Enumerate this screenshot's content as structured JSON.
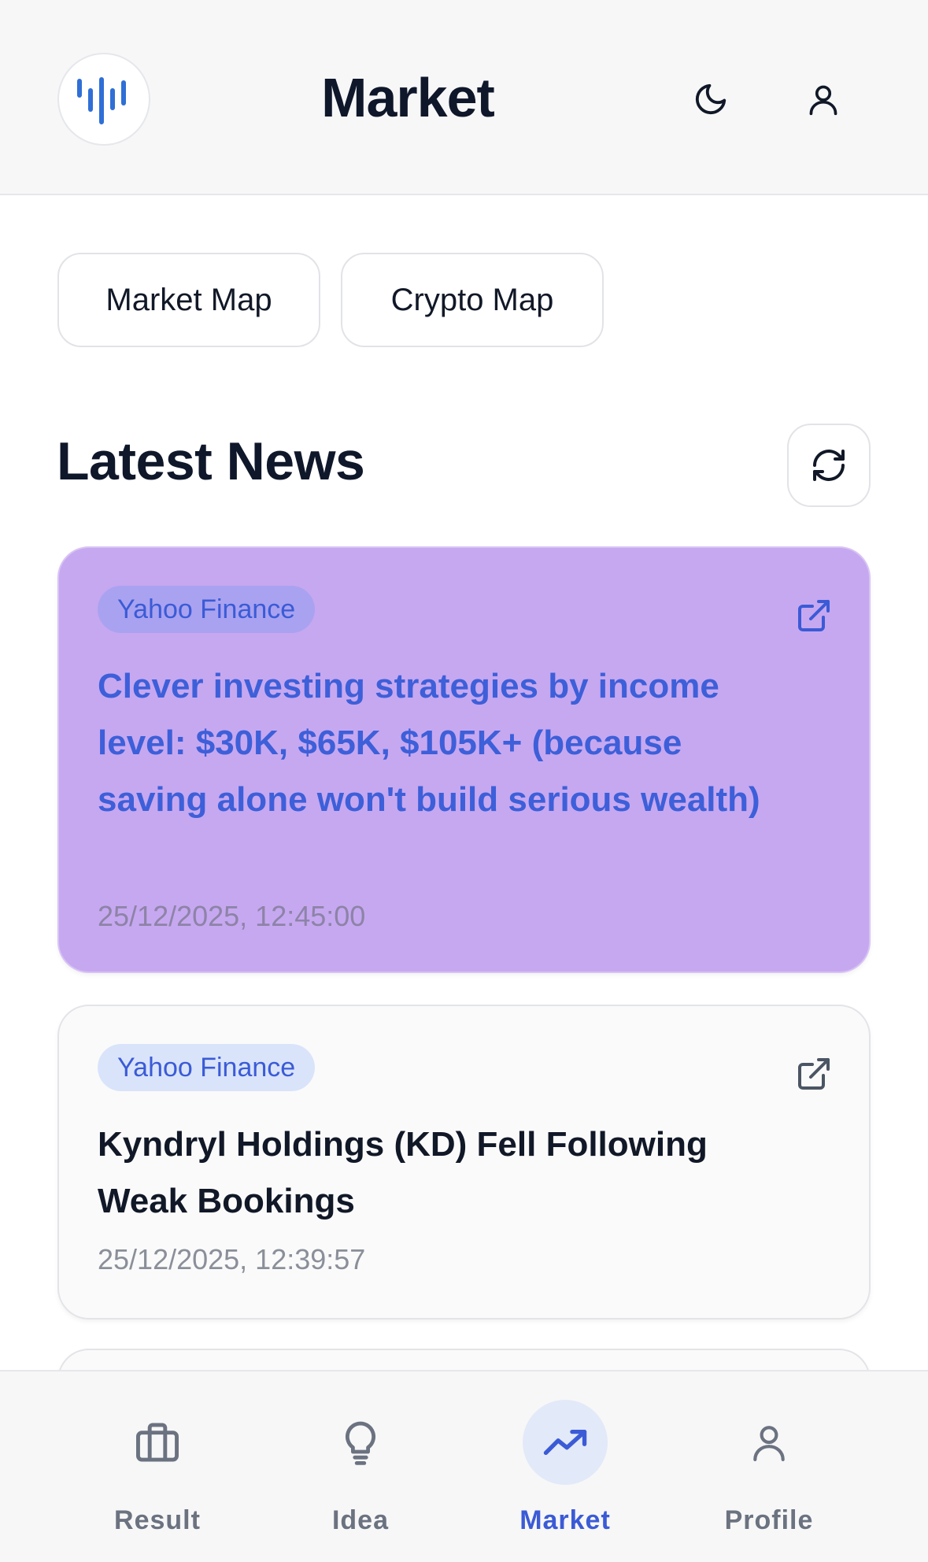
{
  "header": {
    "title": "Market",
    "logo_icon": "bar-chart-logo-icon",
    "theme_icon": "moon-icon",
    "profile_icon": "user-icon"
  },
  "maps": {
    "market_map": "Market Map",
    "crypto_map": "Crypto Map"
  },
  "news": {
    "title": "Latest News",
    "refresh_icon": "refresh-icon",
    "items": [
      {
        "source": "Yahoo Finance",
        "headline": "Clever investing strategies by income level: $30K, $65K, $105K+ (because saving alone won't build serious wealth)",
        "timestamp": "25/12/2025, 12:45:00",
        "highlighted": true
      },
      {
        "source": "Yahoo Finance",
        "headline": "Kyndryl Holdings (KD) Fell Following Weak Bookings",
        "timestamp": "25/12/2025, 12:39:57",
        "highlighted": false
      }
    ]
  },
  "bottom_nav": {
    "items": [
      {
        "label": "Result",
        "icon": "briefcase-icon",
        "active": false
      },
      {
        "label": "Idea",
        "icon": "lightbulb-icon",
        "active": false
      },
      {
        "label": "Market",
        "icon": "trending-up-icon",
        "active": true
      },
      {
        "label": "Profile",
        "icon": "user-icon",
        "active": false
      }
    ]
  },
  "colors": {
    "accent": "#3b5bd6",
    "highlight_card": "#c6a8f0",
    "badge_bg": "#d9e4fb",
    "text_dark": "#0f172a",
    "muted": "#8a8f99"
  }
}
